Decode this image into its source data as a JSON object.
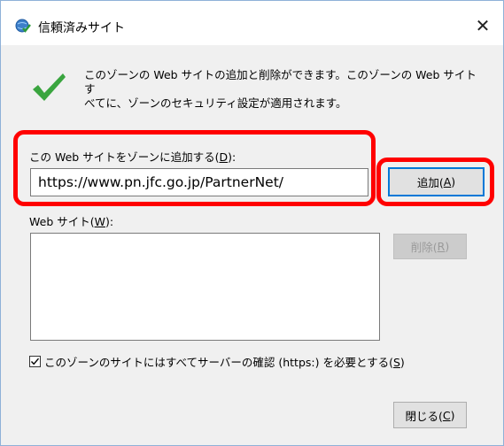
{
  "dialog": {
    "title": "信頼済みサイト",
    "close_glyph": "✕"
  },
  "info": {
    "line1": "このゾーンの Web サイトの追加と削除ができます。このゾーンの Web サイトす",
    "line2": "べてに、ゾーンのセキュリティ設定が適用されます。"
  },
  "add_section": {
    "label_prefix": "この Web サイトをゾーンに追加する(",
    "label_key": "D",
    "label_suffix": "):",
    "url_value": "https://www.pn.jfc.go.jp/PartnerNet/",
    "add_button_prefix": "追加(",
    "add_button_key": "A",
    "add_button_suffix": ")"
  },
  "websites_section": {
    "label_prefix": "Web サイト(",
    "label_key": "W",
    "label_suffix": "):",
    "remove_button_prefix": "削除(",
    "remove_button_key": "R",
    "remove_button_suffix": ")"
  },
  "https_option": {
    "checked": true,
    "label_prefix": "このゾーンのサイトにはすべてサーバーの確認 (https:) を必要とする(",
    "label_key": "S",
    "label_suffix": ")"
  },
  "footer": {
    "close_button_prefix": "閉じる(",
    "close_button_key": "C",
    "close_button_suffix": ")"
  },
  "icons": {
    "title": "globe-check-icon",
    "info": "green-check-icon"
  },
  "colors": {
    "highlight": "#ff0000",
    "check_green": "#3aa53f",
    "focus_blue": "#0078d7"
  }
}
